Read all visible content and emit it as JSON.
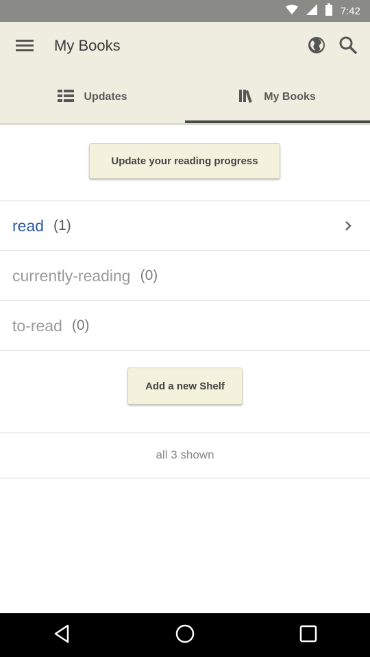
{
  "status_bar": {
    "time": "7:42",
    "icons": [
      "wifi-icon",
      "signal-icon",
      "battery-icon"
    ]
  },
  "app_bar": {
    "title": "My Books",
    "icons": [
      "menu-icon",
      "globe-icon",
      "search-icon"
    ]
  },
  "tabs": [
    {
      "label": "Updates",
      "icon": "list-icon",
      "active": false
    },
    {
      "label": "My Books",
      "icon": "books-icon",
      "active": true
    }
  ],
  "update_button_label": "Update your reading progress",
  "shelves": [
    {
      "name": "read",
      "count": "(1)",
      "active": true
    },
    {
      "name": "currently-reading",
      "count": "(0)",
      "active": false
    },
    {
      "name": "to-read",
      "count": "(0)",
      "active": false
    }
  ],
  "add_shelf_label": "Add a new Shelf",
  "footer_text": "all 3 shown",
  "nav_bar": {
    "icons": [
      "back-icon",
      "home-icon",
      "recents-icon"
    ]
  },
  "colors": {
    "status_bar": "#8a8a86",
    "app_bar": "#efeddf",
    "accent_link": "#2c5aa0",
    "button_bg": "#f4f1dc"
  }
}
